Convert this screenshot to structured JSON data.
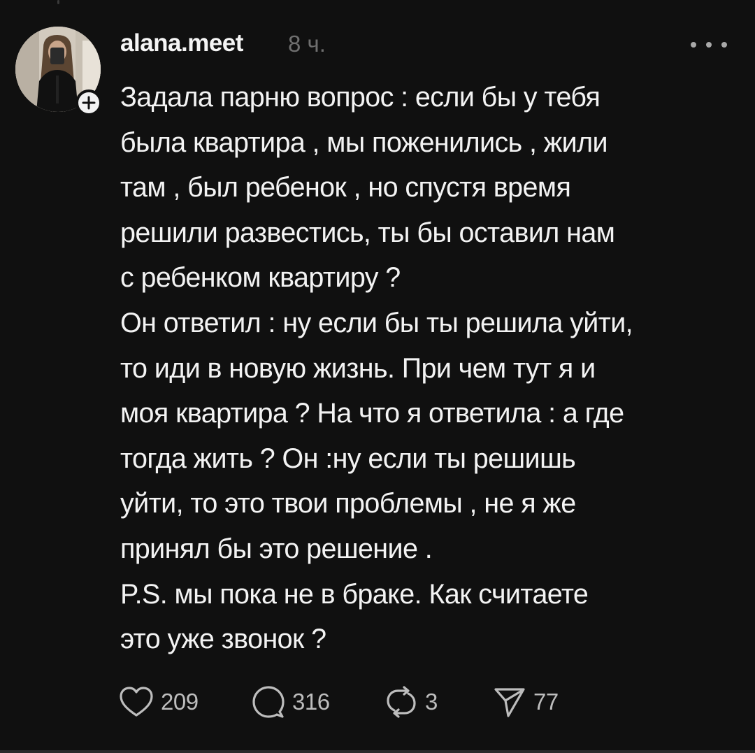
{
  "post": {
    "username": "alana.meet",
    "time": "8 ч.",
    "body_lines": [
      "Задала парню вопрос : если бы у тебя",
      "была квартира , мы поженились , жили",
      "там , был ребенок , но спустя время",
      "решили развестись, ты бы оставил нам",
      "с ребенком квартиру ?",
      "Он ответил : ну если бы ты решила уйти,",
      "то иди в новую жизнь. При чем тут я и",
      "моя квартира ? На что я ответила : а где",
      "тогда жить ? Он :ну если ты решишь",
      "уйти, то это твои проблемы , не я же",
      "принял бы это решение .",
      "P.S. мы пока не в браке. Как считаете",
      "это уже звонок ?"
    ]
  },
  "actions": {
    "likes": "209",
    "comments": "316",
    "reposts": "3",
    "shares": "77"
  },
  "icons": {
    "avatar": "avatar",
    "follow": "plus-icon",
    "more": "more-horizontal-icon",
    "like": "heart-icon",
    "comment": "comment-bubble-icon",
    "repost": "repost-icon",
    "share": "send-icon"
  },
  "colors": {
    "background": "#101010",
    "text": "#f3f3f3",
    "muted": "#6f6f6f",
    "icon": "#bdbdbd"
  }
}
